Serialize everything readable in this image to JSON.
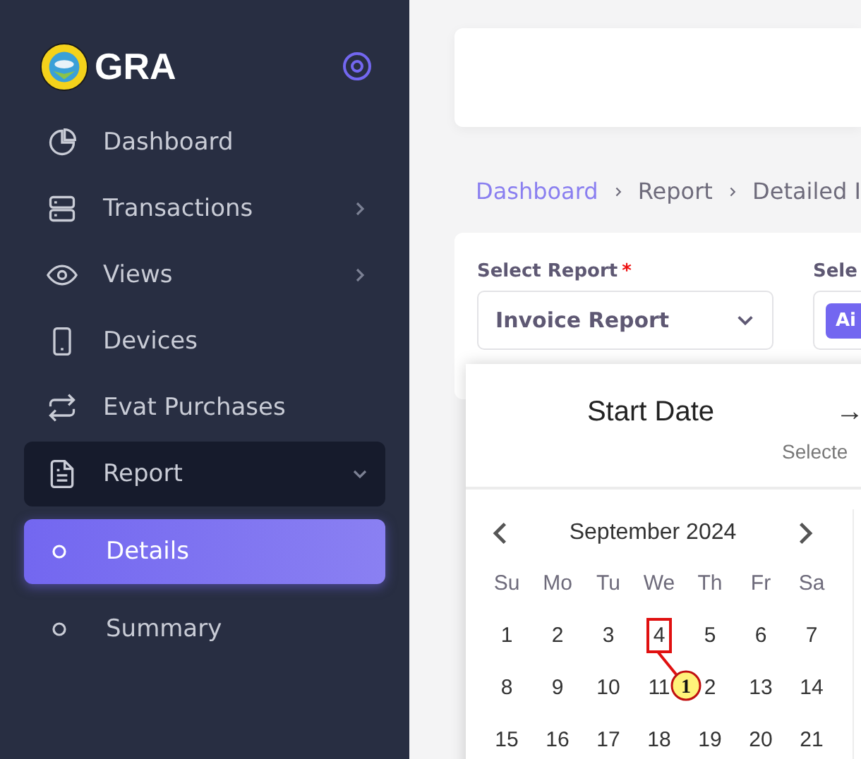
{
  "sidebar": {
    "logo_text": "GRA",
    "items": [
      {
        "label": "Dashboard",
        "has_children": false,
        "expanded": false,
        "selected": false
      },
      {
        "label": "Transactions",
        "has_children": true,
        "expanded": false,
        "selected": false
      },
      {
        "label": "Views",
        "has_children": true,
        "expanded": false,
        "selected": false
      },
      {
        "label": "Devices",
        "has_children": false,
        "expanded": false,
        "selected": false
      },
      {
        "label": "Evat Purchases",
        "has_children": false,
        "expanded": false,
        "selected": false
      },
      {
        "label": "Report",
        "has_children": true,
        "expanded": true,
        "selected": false,
        "children": [
          {
            "label": "Details",
            "selected": true
          },
          {
            "label": "Summary",
            "selected": false
          }
        ]
      }
    ]
  },
  "breadcrumb": [
    {
      "label": "Dashboard",
      "link": true
    },
    {
      "label": "Report",
      "link": false
    },
    {
      "label": "Detailed I",
      "link": false
    }
  ],
  "form": {
    "select_report": {
      "label": "Select Report",
      "required_mark": "*",
      "value": "Invoice Report"
    },
    "second_field": {
      "label": "Sele",
      "chip": "Ai"
    }
  },
  "date_picker": {
    "title": "Start Date",
    "arrow": "→",
    "selected_label": "Selecte",
    "month": "September 2024",
    "weekdays": [
      "Su",
      "Mo",
      "Tu",
      "We",
      "Th",
      "Fr",
      "Sa"
    ],
    "weeks": [
      [
        {
          "label": "1",
          "marked": false
        },
        {
          "label": "2",
          "marked": false
        },
        {
          "label": "3",
          "marked": false
        },
        {
          "label": "4",
          "marked": true
        },
        {
          "label": "5",
          "marked": false
        },
        {
          "label": "6",
          "marked": false
        },
        {
          "label": "7",
          "marked": false
        }
      ],
      [
        {
          "label": "8",
          "marked": false
        },
        {
          "label": "9",
          "marked": false
        },
        {
          "label": "10",
          "marked": false
        },
        {
          "label": "11",
          "marked": false
        },
        {
          "label": "2",
          "marked": false
        },
        {
          "label": "13",
          "marked": false
        },
        {
          "label": "14",
          "marked": false
        }
      ],
      [
        {
          "label": "15",
          "marked": false
        },
        {
          "label": "16",
          "marked": false
        },
        {
          "label": "17",
          "marked": false
        },
        {
          "label": "18",
          "marked": false
        },
        {
          "label": "19",
          "marked": false
        },
        {
          "label": "20",
          "marked": false
        },
        {
          "label": "21",
          "marked": false
        }
      ]
    ],
    "callout": "1"
  }
}
